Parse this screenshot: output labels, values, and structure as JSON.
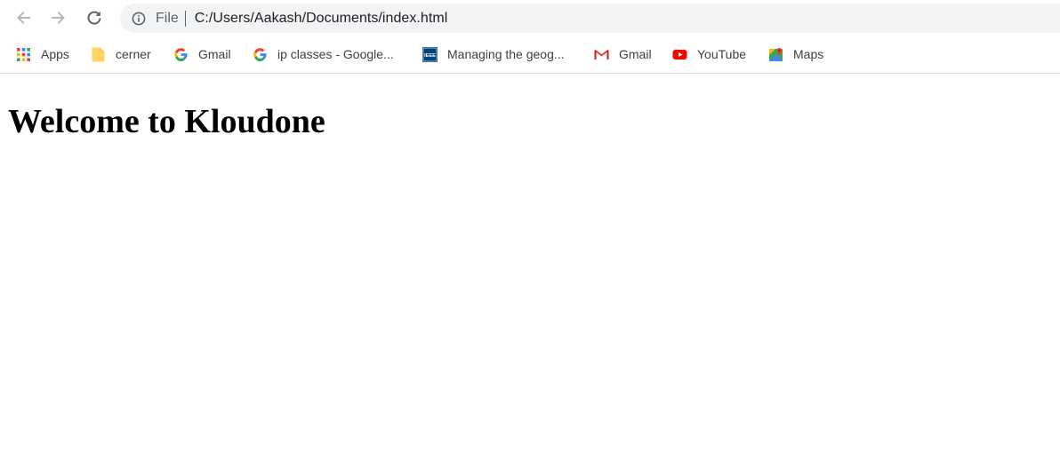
{
  "browser": {
    "address_bar": {
      "scheme_label": "File",
      "url": "C:/Users/Aakash/Documents/index.html"
    },
    "bookmarks": [
      {
        "label": "Apps",
        "icon": "apps-grid-icon"
      },
      {
        "label": "cerner",
        "icon": "folder-icon"
      },
      {
        "label": "Gmail",
        "icon": "google-g-icon"
      },
      {
        "label": "ip classes - Google...",
        "icon": "google-g-icon"
      },
      {
        "label": "Managing the geog...",
        "icon": "ieee-icon"
      },
      {
        "label": "Gmail",
        "icon": "gmail-m-icon"
      },
      {
        "label": "YouTube",
        "icon": "youtube-icon"
      },
      {
        "label": "Maps",
        "icon": "maps-icon"
      }
    ],
    "ieee_badge": "IEEE"
  },
  "page": {
    "heading": "Welcome to Kloudone"
  },
  "colors": {
    "toolbar_bg": "#ffffff",
    "omnibox_bg": "#f1f3f4",
    "page_text": "#000000",
    "youtube_red": "#ff0000",
    "folder_yellow": "#fdd663"
  }
}
